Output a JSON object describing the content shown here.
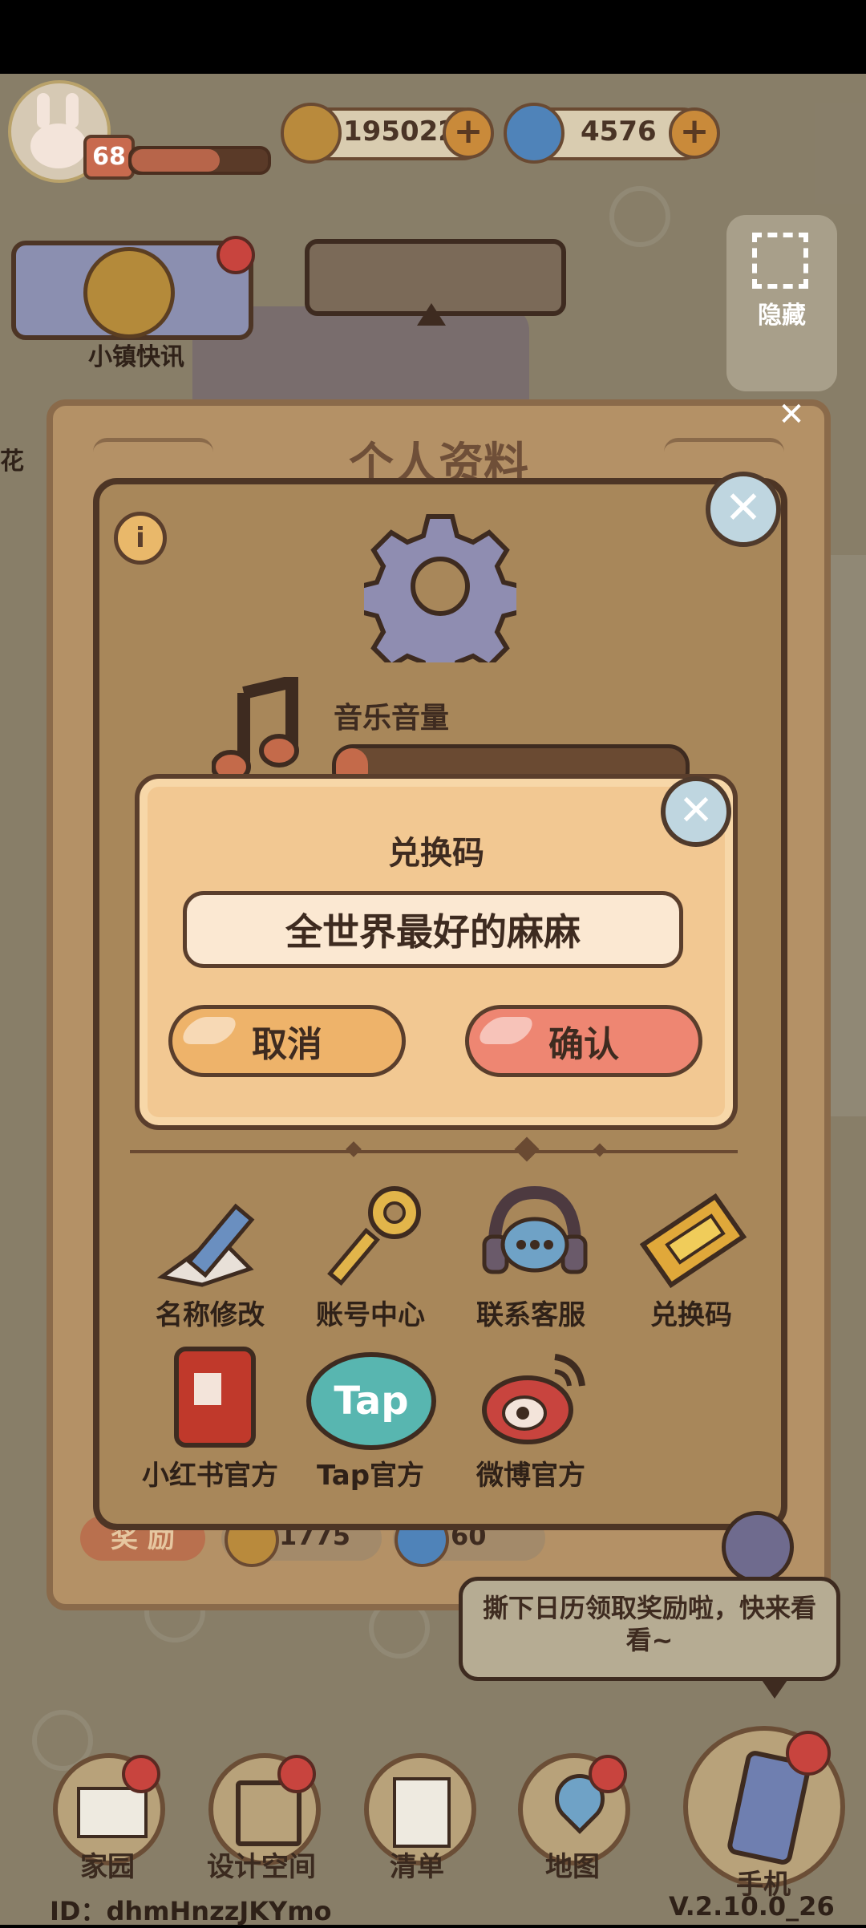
{
  "hud": {
    "level": "68",
    "coins": "195022",
    "gems": "4576",
    "news_label": "小镇快讯",
    "hide_label": "隐藏",
    "side_label": "花"
  },
  "panel": {
    "title": "个人资料",
    "music_volume_label": "音乐音量",
    "music_volume": 0.05
  },
  "dialog": {
    "title": "兑换码",
    "code_value": "全世界最好的麻麻",
    "cancel_label": "取消",
    "confirm_label": "确认"
  },
  "menu": {
    "rename": "名称修改",
    "account": "账号中心",
    "support": "联系客服",
    "redeem": "兑换码",
    "xiaohongshu": "小红书官方",
    "tap": "Tap官方",
    "tap_logo": "Tap",
    "weibo": "微博官方"
  },
  "reward": {
    "label": "奖 励",
    "coins": "1775",
    "gems": "60"
  },
  "bubble": {
    "text": "撕下日历领取奖励啦，快来看看~"
  },
  "nav": {
    "home": "家园",
    "design": "设计空间",
    "list": "清单",
    "map": "地图",
    "phone": "手机"
  },
  "footer": {
    "id": "ID：dhmHnzzJKYmo",
    "version": "V.2.10.0_26"
  },
  "colors": {
    "accent_cancel": "#eeb36a",
    "accent_confirm": "#ee8672",
    "panel": "#a8875a"
  }
}
